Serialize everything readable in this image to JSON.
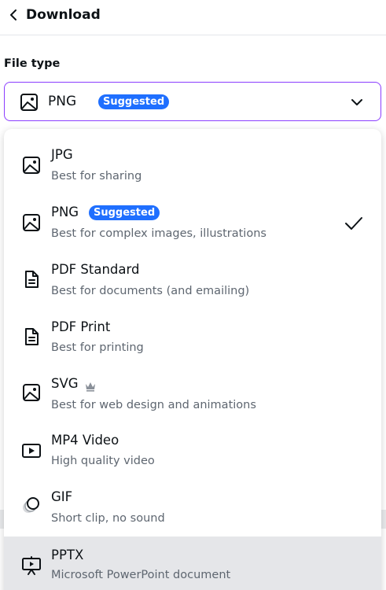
{
  "header": {
    "title": "Download",
    "back_icon": "chevron-left-icon"
  },
  "file_type": {
    "label": "File type",
    "selected_value": "PNG",
    "selected_badge": "Suggested",
    "selected_icon": "image-icon",
    "dropdown_icon": "chevron-down-icon"
  },
  "options": [
    {
      "title": "JPG",
      "subtitle": "Best for sharing",
      "icon": "image-icon"
    },
    {
      "title": "PNG",
      "subtitle": "Best for complex images, illustrations",
      "badge": "Suggested",
      "selected": true,
      "icon": "image-icon"
    },
    {
      "title": "PDF Standard",
      "subtitle": "Best for documents (and emailing)",
      "icon": "document-icon"
    },
    {
      "title": "PDF Print",
      "subtitle": "Best for printing",
      "icon": "document-icon"
    },
    {
      "title": "SVG",
      "subtitle": "Best for web design and animations",
      "premium": true,
      "icon": "image-icon"
    },
    {
      "title": "MP4 Video",
      "subtitle": "High quality video",
      "icon": "video-play-icon"
    },
    {
      "title": "GIF",
      "subtitle": "Short clip, no sound",
      "icon": "gif-circles-icon"
    },
    {
      "title": "PPTX",
      "subtitle": "Microsoft PowerPoint document",
      "highlighted": true,
      "icon": "presentation-icon"
    }
  ],
  "colors": {
    "accent_border": "#8b3dff",
    "badge": "#1f6fff",
    "hover": "#e5e6e9"
  }
}
